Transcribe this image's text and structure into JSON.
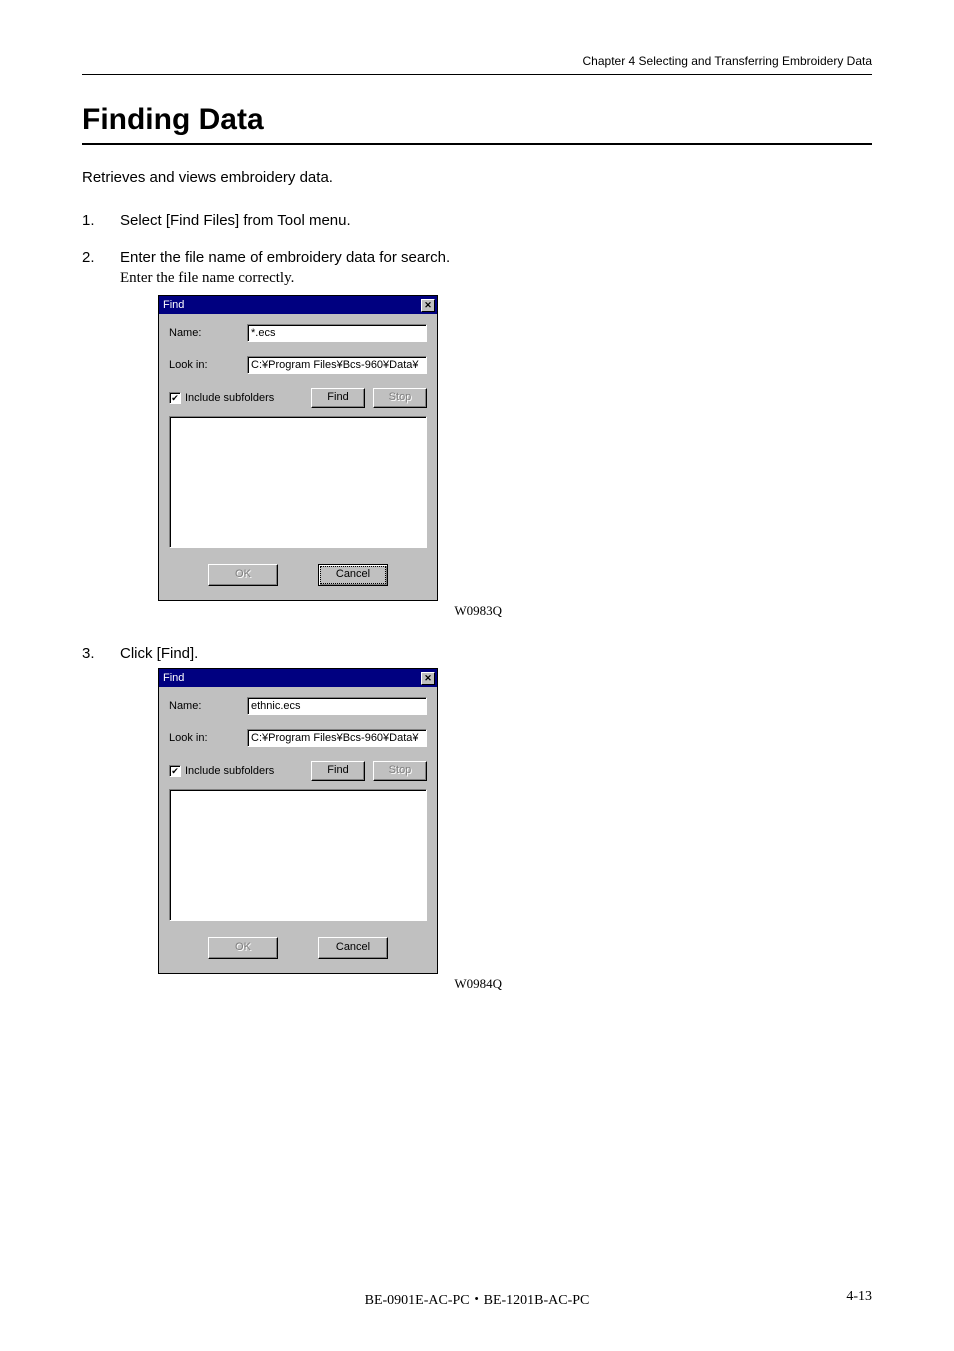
{
  "header": {
    "chapter_line": "Chapter 4   Selecting and Transferring Embroidery Data"
  },
  "title": "Finding Data",
  "intro": "Retrieves and views embroidery data.",
  "steps": [
    {
      "num": "1.",
      "main": "Select [Find Files] from Tool menu."
    },
    {
      "num": "2.",
      "main": "Enter the file name of embroidery data for search.",
      "sub": "Enter the file name correctly."
    },
    {
      "num": "3.",
      "main": "Click [Find]."
    }
  ],
  "dialog1": {
    "title": "Find",
    "close_glyph": "✕",
    "name_label": "Name:",
    "name_value": "*.ecs",
    "lookin_label": "Look in:",
    "lookin_value": "C:¥Program Files¥Bcs-960¥Data¥",
    "check_glyph": "✔",
    "subfolders_label": "Include subfolders",
    "find_label": "Find",
    "stop_label": "Stop",
    "ok_label": "OK",
    "cancel_label": "Cancel",
    "caption": "W0983Q"
  },
  "dialog2": {
    "title": "Find",
    "close_glyph": "✕",
    "name_label": "Name:",
    "name_value": "ethnic.ecs",
    "lookin_label": "Look in:",
    "lookin_value": "C:¥Program Files¥Bcs-960¥Data¥",
    "check_glyph": "✔",
    "subfolders_label": "Include subfolders",
    "find_label": "Find",
    "stop_label": "Stop",
    "ok_label": "OK",
    "cancel_label": "Cancel",
    "caption": "W0984Q"
  },
  "footer": {
    "center": "BE-0901E-AC-PC・BE-1201B-AC-PC",
    "right": "4-13"
  }
}
